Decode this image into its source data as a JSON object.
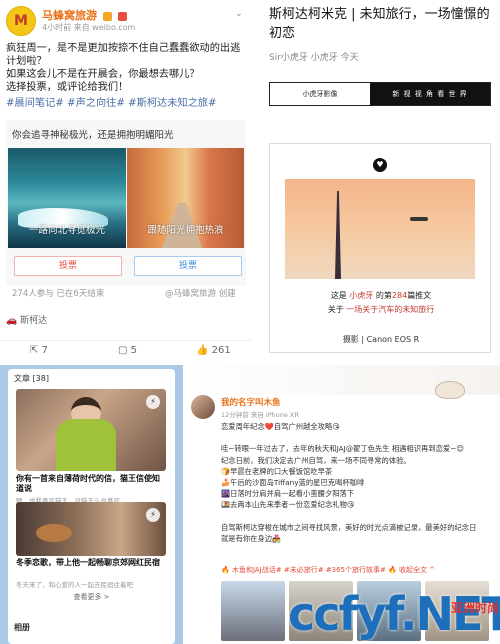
{
  "weibo": {
    "account_name": "马蜂窝旅游",
    "avatar_icon": "mafengwo-logo-icon",
    "meta": "4小时前  来自 weibo.com",
    "chevron_icon": "chevron-down-icon",
    "text": "疯狂周一，是不是更加按捺不住自己蠢蠢欲动的出逃计划啦？\n如果这会儿不是在开晨会，你最想去哪儿？\n选择投票，或评论给我们！",
    "tags": "#晨间笔记# #声之向往# #斯柯达未知之旅#",
    "poll": {
      "title": "你会追寻神秘极光，还是拥抱明媚阳光",
      "option_left": "一路向北寻觅极光",
      "option_right": "跟随阳光拥抱热浪",
      "vote_left": "投票",
      "vote_right": "投票",
      "stats": "274人参与  已在6天结束",
      "source": "@马蜂窝旅游 创建"
    },
    "location_icon": "car-icon",
    "location": "斯柯达",
    "actions": {
      "share_icon": "share-icon",
      "share": "7",
      "comment_icon": "comment-icon",
      "comment": "5",
      "like_icon": "thumbs-up-icon",
      "like": "261"
    }
  },
  "article": {
    "title": "斯柯达柯米克 | 未知旅行，一场憧憬的初恋",
    "meta": "Sir小虎牙   小虎牙   今天",
    "banner_left": "小虎牙影像",
    "banner_right": "新 视 视 角 看 世 界",
    "heart_icon": "heart-icon",
    "line1_a": "这是 ",
    "line1_b": "小虎牙",
    "line1_c": " 的第",
    "line1_d": "284",
    "line1_e": "篇推文",
    "line2_a": "关于 ",
    "line2_b": "一场关于汽车的未知旅行",
    "credit": "摄影 | Canon EOS R"
  },
  "mobile": {
    "header": "文章 [38]",
    "lightning_icon": "lightning-icon",
    "item1_title": "你有一首来自薄荷时代的信，猫王信使知道说",
    "item1_sub": "嗯，说我喜欢猫王，对猫王么也喜欢",
    "item2_title": "冬季恋歌，带上他一起畅聊京郊网红民宿",
    "item2_sub": "冬天来了，和心爱的人一起去民宿住着吧",
    "more": "查看更多  >",
    "footer": "相册"
  },
  "weibo2": {
    "name": "我的名字叫木鱼",
    "meta": "12分钟前 来自 iPhone XR",
    "lines": [
      "恋爱周年纪念❤️自驾广州越全攻略😘",
      "",
      "哇~转眼一年过去了，去年的秋天和JAJ@翟丁色先生 相遇相识再到恋爱~😊",
      "纪念日前，我们决定去广州自驾，来一场不同寻常的体验。",
      "🍞早晨在老牌的口大餐饭馆吃早茶",
      "🍰午后的沙面岛Tiffany蓝的星巴克喝杯咖啡",
      "🌆日落时分肩并肩一起看小蛮腰夕阳落下",
      "🍱去两本山先来季者一份恋爱纪念礼物😘",
      "",
      "自驾斯柯达穿梭在城市之间寻找风景，美好的时光点滴被记录，最美好的纪念日",
      "就是有你在身边👩‍❤️‍👨"
    ],
    "tags": "🔥 木鱼和JAJ战话# #未必旅行# #365个旅行故事# 🔥 收起全文 ^"
  },
  "watermark": {
    "logo": "ccfyf.NET",
    "cn": "亚洲时尚",
    "net": ".NET"
  }
}
